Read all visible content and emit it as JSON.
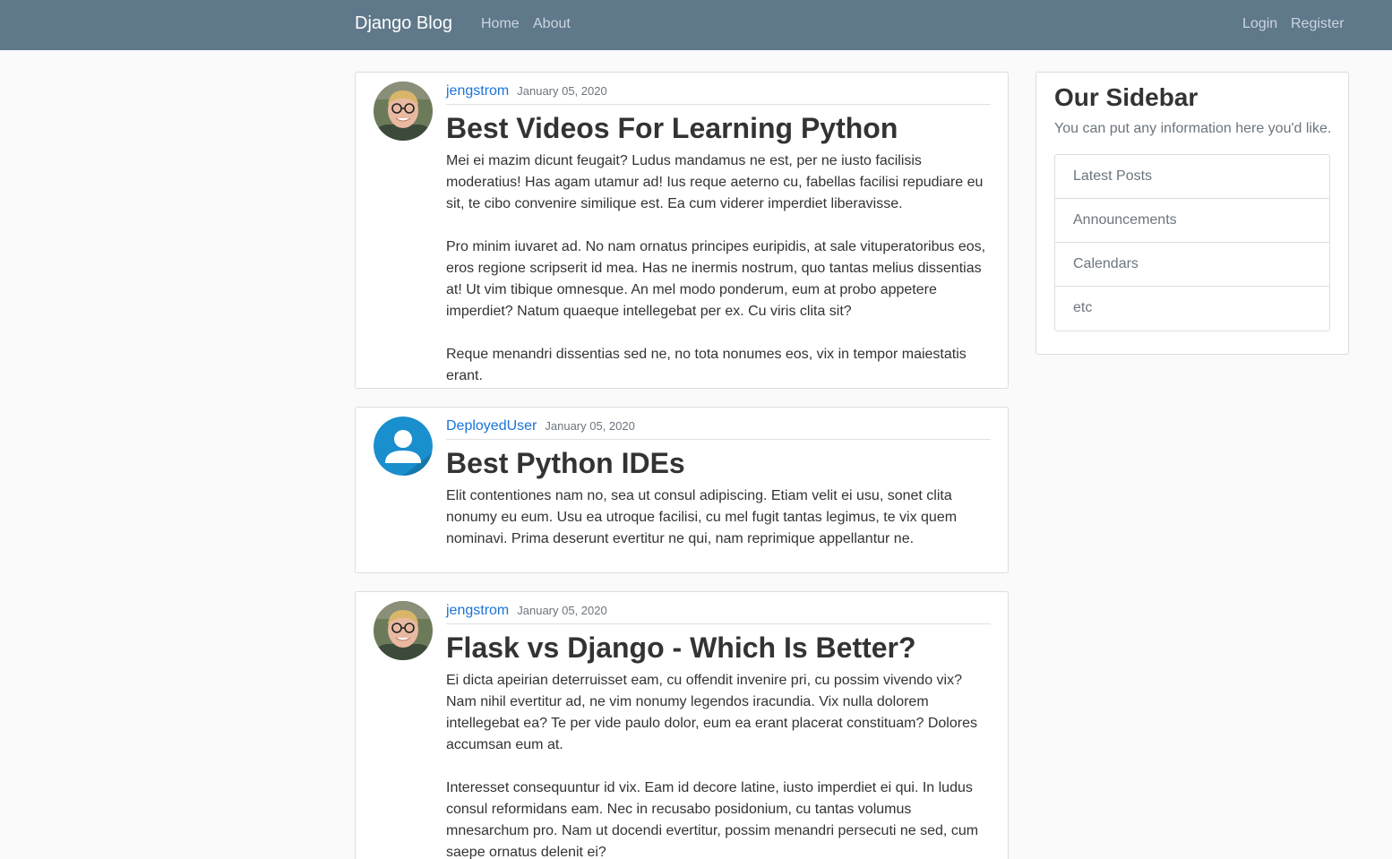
{
  "navbar": {
    "brand": "Django Blog",
    "links": [
      "Home",
      "About"
    ],
    "auth_links": [
      "Login",
      "Register"
    ],
    "background": "#5f788a"
  },
  "posts": [
    {
      "author": "jengstrom",
      "date": "January 05, 2020",
      "title": "Best Videos For Learning Python",
      "avatar": "profile-photo",
      "paragraphs": [
        "Mei ei mazim dicunt feugait? Ludus mandamus ne est, per ne iusto facilisis moderatius! Has agam utamur ad! Ius reque aeterno cu, fabellas facilisi repudiare eu sit, te cibo convenire similique est. Ea cum viderer imperdiet liberavisse.",
        "Pro minim iuvaret ad. No nam ornatus principes euripidis, at sale vituperatoribus eos, eros regione scripserit id mea. Has ne inermis nostrum, quo tantas melius dissentias at! Ut vim tibique omnesque. An mel modo ponderum, eum at probo appetere imperdiet? Natum quaeque intellegebat per ex. Cu viris clita sit?",
        "Reque menandri dissentias sed ne, no tota nonumes eos, vix in tempor maiestatis erant."
      ]
    },
    {
      "author": "DeployedUser",
      "date": "January 05, 2020",
      "title": "Best Python IDEs",
      "avatar": "default-user-icon",
      "paragraphs": [
        "Elit contentiones nam no, sea ut consul adipiscing. Etiam velit ei usu, sonet clita nonumy eu eum. Usu ea utroque facilisi, cu mel fugit tantas legimus, te vix quem nominavi. Prima deserunt evertitur ne qui, nam reprimique appellantur ne."
      ]
    },
    {
      "author": "jengstrom",
      "date": "January 05, 2020",
      "title": "Flask vs Django - Which Is Better?",
      "avatar": "profile-photo",
      "paragraphs": [
        "Ei dicta apeirian deterruisset eam, cu offendit invenire pri, cu possim vivendo vix? Nam nihil evertitur ad, ne vim nonumy legendos iracundia. Vix nulla dolorem intellegebat ea? Te per vide paulo dolor, eum ea erant placerat constituam? Dolores accumsan eum at.",
        "Interesset consequuntur id vix. Eam id decore latine, iusto imperdiet ei qui. In ludus consul reformidans eam. Nec in recusabo posidonium, cu tantas volumus mnesarchum pro. Nam ut docendi evertitur, possim menandri persecuti ne sed, cum saepe ornatus delenit ei?"
      ]
    }
  ],
  "sidebar": {
    "title": "Our Sidebar",
    "text": "You can put any information here you'd like.",
    "items": [
      "Latest Posts",
      "Announcements",
      "Calendars",
      "etc"
    ]
  }
}
